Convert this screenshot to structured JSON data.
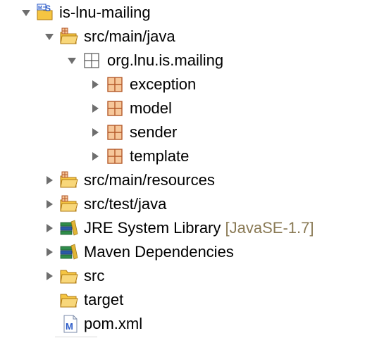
{
  "colors": {
    "arrow": "#6e6e6e",
    "decoration": "#8a7a55",
    "package_fill": "#f6c79a",
    "package_stroke": "#b45a2a",
    "folder_fill": "#f5c542",
    "folder_stroke": "#b07a10",
    "library_green": "#2f8c4a",
    "library_blue": "#2b5aa8",
    "library_yellow": "#e2b536",
    "project_blue": "#2a5ac8"
  },
  "tree": {
    "project": {
      "label": "is-lnu-mailing",
      "expanded": true,
      "icon": "maven-project-icon"
    },
    "src_main_java": {
      "label": "src/main/java",
      "expanded": true,
      "icon": "source-folder-icon"
    },
    "package_root": {
      "label": "org.lnu.is.mailing",
      "expanded": true,
      "icon": "empty-package-icon"
    },
    "packages": [
      {
        "label": "exception",
        "expanded": false,
        "icon": "package-icon"
      },
      {
        "label": "model",
        "expanded": false,
        "icon": "package-icon"
      },
      {
        "label": "sender",
        "expanded": false,
        "icon": "package-icon"
      },
      {
        "label": "template",
        "expanded": false,
        "icon": "package-icon"
      }
    ],
    "src_main_resources": {
      "label": "src/main/resources",
      "expanded": false,
      "icon": "source-folder-icon"
    },
    "src_test_java": {
      "label": "src/test/java",
      "expanded": false,
      "icon": "source-folder-icon"
    },
    "jre": {
      "label": "JRE System Library",
      "decoration": "[JavaSE-1.7]",
      "expanded": false,
      "icon": "library-icon"
    },
    "maven_deps": {
      "label": "Maven Dependencies",
      "expanded": false,
      "icon": "library-icon"
    },
    "src": {
      "label": "src",
      "expanded": false,
      "icon": "folder-icon"
    },
    "target": {
      "label": "target",
      "icon": "folder-icon"
    },
    "pom": {
      "label": "pom.xml",
      "icon": "maven-file-icon"
    }
  }
}
